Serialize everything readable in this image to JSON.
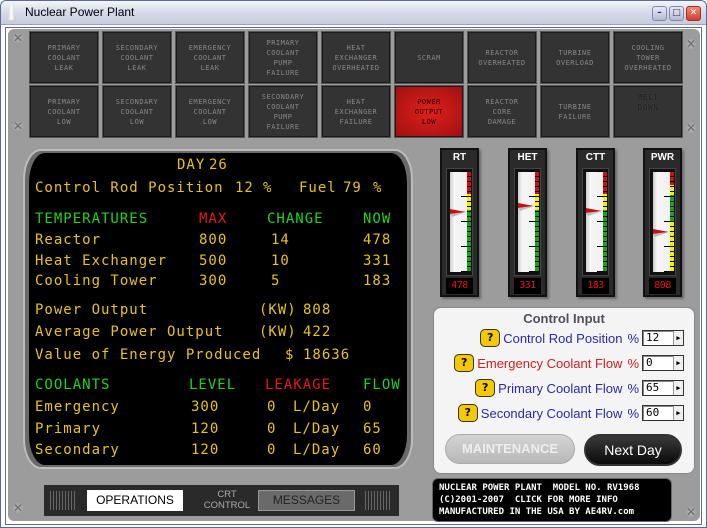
{
  "window": {
    "title": "Nuclear Power Plant",
    "minimize": "–",
    "maximize": "□",
    "close": "✕"
  },
  "alarms": {
    "row1": [
      {
        "label": "Primary\nCoolant\nLeak",
        "active": false
      },
      {
        "label": "Secondary\nCoolant\nLeak",
        "active": false
      },
      {
        "label": "Emergency\nCoolant\nLeak",
        "active": false
      },
      {
        "label": "Primary\nCoolant\nPump\nFailure",
        "active": false
      },
      {
        "label": "Heat\nExchanger\nOverheated",
        "active": false
      },
      {
        "label": "Scram",
        "active": false
      },
      {
        "label": "Reactor\nOverheated",
        "active": false
      },
      {
        "label": "Turbine\nOverload",
        "active": false
      },
      {
        "label": "Cooling\nTower\nOverheated",
        "active": false
      }
    ],
    "row2": [
      {
        "label": "Primary\nCoolant\nLow",
        "active": false
      },
      {
        "label": "Secondary\nCoolant\nLow",
        "active": false
      },
      {
        "label": "Emergency\nCoolant\nLow",
        "active": false
      },
      {
        "label": "Secondary\nCoolant\nPump\nFailure",
        "active": false
      },
      {
        "label": "Heat\nExchanger\nFailure",
        "active": false
      },
      {
        "label": "Power\nOutput\nLow",
        "active": true
      },
      {
        "label": "Reactor\nCore\nDamage",
        "active": false
      },
      {
        "label": "Turbine\nFailure",
        "active": false
      },
      {
        "label": "Melt\nDown",
        "active": false
      }
    ]
  },
  "crt": {
    "day_label": "DAY",
    "day": "26",
    "control_rod_label": "Control Rod Position",
    "control_rod_value": "12",
    "control_rod_unit": "%",
    "fuel_label": "Fuel",
    "fuel_value": "79",
    "fuel_unit": "%",
    "temps": {
      "headers": [
        "TEMPERATURES",
        "MAX",
        "CHANGE",
        "NOW"
      ],
      "rows": [
        {
          "name": "Reactor",
          "max": "800",
          "change": "14",
          "now": "478"
        },
        {
          "name": "Heat Exchanger",
          "max": "500",
          "change": "10",
          "now": "331"
        },
        {
          "name": "Cooling Tower",
          "max": "300",
          "change": "5",
          "now": "183"
        }
      ]
    },
    "power": {
      "output_label": "Power Output",
      "output_unit": "(KW)",
      "output_value": "808",
      "avg_label": "Average Power Output",
      "avg_unit": "(KW)",
      "avg_value": "422",
      "energy_label": "Value of Energy Produced",
      "energy_unit": "$",
      "energy_value": "18636"
    },
    "coolants": {
      "headers": [
        "COOLANTS",
        "LEVEL",
        "LEAKAGE",
        "FLOW"
      ],
      "rows": [
        {
          "name": "Emergency",
          "level": "300",
          "leakage": "0",
          "leak_unit": "L/Day",
          "flow": "0"
        },
        {
          "name": "Primary",
          "level": "120",
          "leakage": "0",
          "leak_unit": "L/Day",
          "flow": "65"
        },
        {
          "name": "Secondary",
          "level": "120",
          "leakage": "0",
          "leak_unit": "L/Day",
          "flow": "60"
        }
      ]
    }
  },
  "gauges": [
    {
      "label": "RT",
      "readout": "478",
      "level": 0.6,
      "zones": [
        "green",
        "yellow",
        "red"
      ]
    },
    {
      "label": "HET",
      "readout": "331",
      "level": 0.66,
      "zones": [
        "green",
        "yellow",
        "red"
      ]
    },
    {
      "label": "CTT",
      "readout": "183",
      "level": 0.61,
      "zones": [
        "green",
        "yellow",
        "red"
      ]
    },
    {
      "label": "PWR",
      "readout": "808",
      "level": 0.4,
      "zones": [
        "yellow",
        "green",
        "yellow",
        "red"
      ]
    }
  ],
  "control_input": {
    "title": "Control Input",
    "help_label": "?",
    "rows": [
      {
        "label": "Control Rod Position",
        "unit": "%",
        "value": "12",
        "color": "#2a2aa8"
      },
      {
        "label": "Emergency Coolant Flow",
        "unit": "%",
        "value": "0",
        "color": "#d02020"
      },
      {
        "label": "Primary Coolant Flow",
        "unit": "%",
        "value": "65",
        "color": "#2a2aa8"
      },
      {
        "label": "Secondary Coolant Flow",
        "unit": "%",
        "value": "60",
        "color": "#2a2aa8"
      }
    ],
    "maintenance_label": "MAINTENANCE",
    "next_day_label": "Next Day"
  },
  "nameplate": {
    "line1": "NUCLEAR POWER PLANT  MODEL NO. RV1968",
    "line2": "(C)2001-2007  CLICK FOR MORE INFO",
    "line3": "MANUFACTURED IN THE USA BY AE4RV.com"
  },
  "tabs": {
    "operations": "OPERATIONS",
    "crt_control": "CRT\nCONTROL",
    "messages": "MESSAGES"
  }
}
